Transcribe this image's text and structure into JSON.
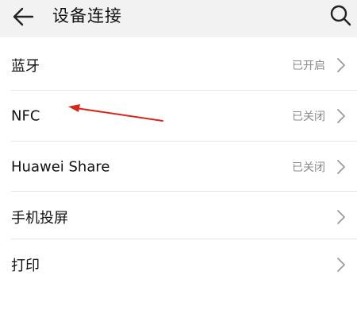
{
  "header": {
    "title": "设备连接",
    "back_icon": "arrow-left-icon",
    "search_icon": "search-icon"
  },
  "items": [
    {
      "label": "蓝牙",
      "status": "已开启"
    },
    {
      "label": "NFC",
      "status": "已关闭"
    },
    {
      "label": "Huawei Share",
      "status": "已关闭"
    },
    {
      "label": "手机投屏",
      "status": ""
    },
    {
      "label": "打印",
      "status": ""
    }
  ],
  "colors": {
    "header_bg": "#f2f2f2",
    "status_text": "#8a8a8a",
    "annotation_arrow": "#d9261c"
  }
}
